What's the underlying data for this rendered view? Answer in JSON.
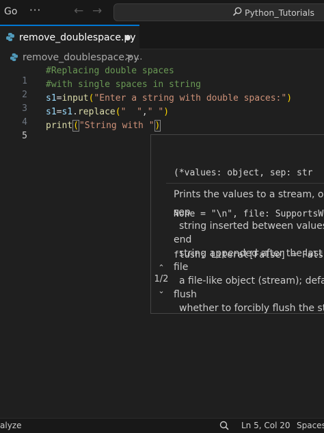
{
  "titlebar": {
    "menu_go": "Go",
    "menu_more": "···",
    "nav_back": "←",
    "nav_forward": "→",
    "search_text": "Python_Tutorials"
  },
  "tab": {
    "label": "remove_doublespace.py",
    "dirty": true,
    "icon": "python-icon"
  },
  "breadcrumb": {
    "file": "remove_doublespace.py",
    "separator": ">",
    "more": "..."
  },
  "editor": {
    "lines": [
      {
        "number": "1",
        "code": "#Replacing double spaces"
      },
      {
        "number": "2",
        "code": "#with single spaces in string"
      },
      {
        "number": "3",
        "code": "s1=input(\"Enter a string with double spaces:\")"
      },
      {
        "number": "4",
        "code": "s1=s1.replace(\"  \",\" \")"
      },
      {
        "number": "5",
        "code": "print(\"String with \")"
      }
    ],
    "line3": {
      "var": "s1",
      "eq": "=",
      "fn": "input",
      "open": "(",
      "str": "\"Enter a string with double spaces:\"",
      "close": ")"
    },
    "line4": {
      "var1": "s1",
      "eq": "=",
      "var2": "s1",
      "dot": ".",
      "fn": "replace",
      "open": "(",
      "str1": "\"  \"",
      "comma": ",",
      "str2": "\" \"",
      "close": ")"
    },
    "line5": {
      "fn": "print",
      "open": "(",
      "str": "\"String with \"",
      "close": ")"
    }
  },
  "hover": {
    "signature_lines": [
      "(*values: object, sep: str",
      "None = \"\\n\", file: SupportsW",
      "flush: Literal[False] = Fals"
    ],
    "description": "Prints the values to a stream, or to",
    "params": [
      {
        "name": "sep",
        "desc": "string inserted between values, d"
      },
      {
        "name": "end",
        "desc": "string appended after the last val"
      },
      {
        "name": "file",
        "desc": "a file-like object (stream); default"
      },
      {
        "name": "flush",
        "desc": "whether to forcibly flush the strea"
      }
    ],
    "pager": "1/2"
  },
  "statusbar": {
    "left": "alyze",
    "position": "Ln 5, Col 20",
    "spaces": "Spaces"
  },
  "colors": {
    "accent": "#0078d4",
    "comment": "#6a9955",
    "string": "#ce9178",
    "function": "#dcdcaa",
    "variable": "#9cdcfe",
    "bracket": "#ffd700"
  }
}
